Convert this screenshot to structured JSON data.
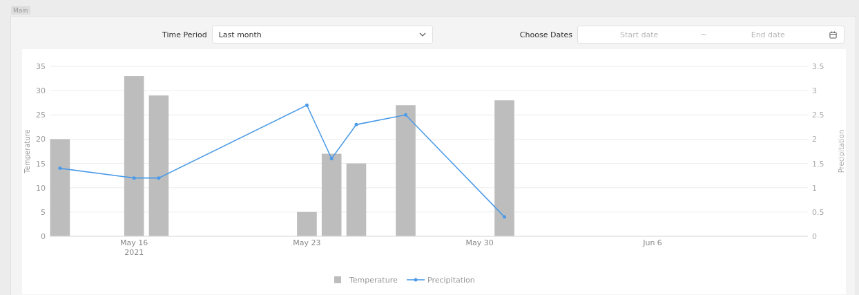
{
  "tab": {
    "label": "Main"
  },
  "filters": {
    "time_period": {
      "label": "Time Period",
      "value": "Last month"
    },
    "dates": {
      "label": "Choose Dates",
      "start_placeholder": "Start date",
      "separator": "~",
      "end_placeholder": "End date"
    }
  },
  "chart": {
    "chart_data": {
      "type": "bar",
      "ylabel": "Temperature",
      "y2label": "Precipitation",
      "x": [
        "2021-05-13",
        "2021-05-16",
        "2021-05-17",
        "2021-05-23",
        "2021-05-24",
        "2021-05-25",
        "2021-05-27",
        "2021-05-31"
      ],
      "series": [
        {
          "name": "Temperature",
          "color": "#bdbdbd",
          "values": [
            20,
            33,
            29,
            5,
            17,
            15,
            27,
            28
          ]
        },
        {
          "name": "Precipitation",
          "type": "line",
          "axis": "y2",
          "color": "#4c9be8",
          "values": [
            1.4,
            1.2,
            1.2,
            2.7,
            1.6,
            2.3,
            2.5,
            0.4
          ]
        }
      ],
      "xlim": [
        "2021-05-12T14:00:00Z",
        "2021-06-12T07:00:00Z"
      ],
      "grid": true,
      "legend": "bottom",
      "ylim": [
        0,
        35
      ],
      "y2lim": [
        0,
        3.5
      ],
      "xticks": [
        {
          "value": "2021-05-16",
          "label": "May 16\n2021"
        },
        {
          "value": "2021-05-23",
          "label": "May 23"
        },
        {
          "value": "2021-05-30",
          "label": "May 30"
        },
        {
          "value": "2021-06-06",
          "label": "Jun 6"
        }
      ],
      "yticks": [
        0,
        5,
        10,
        15,
        20,
        25,
        30,
        35
      ],
      "y2ticks": [
        0,
        0.5,
        1,
        1.5,
        2,
        2.5,
        3,
        3.5
      ]
    }
  }
}
